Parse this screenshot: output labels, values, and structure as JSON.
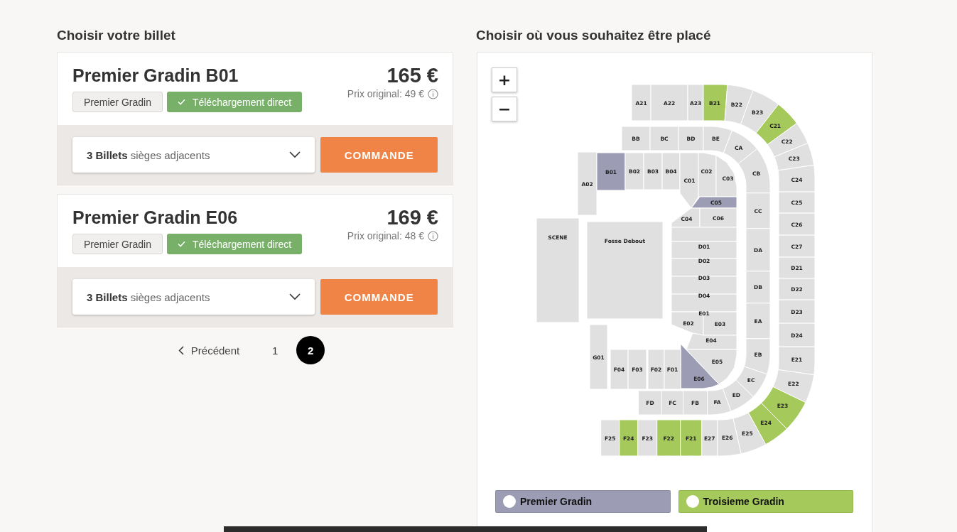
{
  "ticket_panel": {
    "heading": "Choisir votre billet",
    "tickets": [
      {
        "title": "Premier Gradin B01",
        "price": "165 €",
        "original_price": "Prix original: 49 €",
        "tags": [
          {
            "kind": "category",
            "label": "Premier Gradin"
          },
          {
            "kind": "download",
            "label": "Téléchargement direct"
          }
        ],
        "quantity": "**3 Billets** sièges adjacents",
        "order_button": "COMMANDE"
      },
      {
        "title": "Premier Gradin E06",
        "price": "169 €",
        "original_price": "Prix original: 48 €",
        "tags": [
          {
            "kind": "category",
            "label": "Premier Gradin"
          },
          {
            "kind": "download",
            "label": "Téléchargement direct"
          }
        ],
        "quantity": "**3 Billets** sièges adjacents",
        "order_button": "COMMANDE"
      }
    ],
    "pagination": {
      "previous": "Précédent",
      "pages": [
        {
          "label": "1",
          "selected": false
        },
        {
          "label": "2",
          "selected": true
        }
      ]
    }
  },
  "seat_map": {
    "heading": "Choisir où vous souhaitez être placé",
    "zoom_in": "+",
    "zoom_out": "−",
    "sections": [
      {
        "label": "A21",
        "color": "#e0e0e0"
      },
      {
        "label": "A22",
        "color": "#e0e0e0"
      },
      {
        "label": "A23",
        "color": "#e0e0e0"
      },
      {
        "label": "B21",
        "color": "#a5c95a"
      },
      {
        "label": "B22",
        "color": "#e0e0e0"
      },
      {
        "label": "B23",
        "color": "#e0e0e0"
      },
      {
        "label": "C21",
        "color": "#a5c95a"
      },
      {
        "label": "C22",
        "color": "#e0e0e0"
      },
      {
        "label": "C23",
        "color": "#e0e0e0"
      },
      {
        "label": "C24",
        "color": "#e0e0e0"
      },
      {
        "label": "C25",
        "color": "#e0e0e0"
      },
      {
        "label": "C26",
        "color": "#e0e0e0"
      },
      {
        "label": "C27",
        "color": "#e0e0e0"
      },
      {
        "label": "D21",
        "color": "#e0e0e0"
      },
      {
        "label": "D22",
        "color": "#e0e0e0"
      },
      {
        "label": "D23",
        "color": "#e0e0e0"
      },
      {
        "label": "D24",
        "color": "#e0e0e0"
      },
      {
        "label": "E21",
        "color": "#e0e0e0"
      },
      {
        "label": "E22",
        "color": "#e0e0e0"
      },
      {
        "label": "E23",
        "color": "#a5c95a"
      },
      {
        "label": "E24",
        "color": "#a5c95a"
      },
      {
        "label": "E25",
        "color": "#e0e0e0"
      },
      {
        "label": "F25",
        "color": "#e0e0e0"
      },
      {
        "label": "F24",
        "color": "#a5c95a"
      },
      {
        "label": "F23",
        "color": "#e0e0e0"
      },
      {
        "label": "F22",
        "color": "#a5c95a"
      },
      {
        "label": "F21",
        "color": "#a5c95a"
      },
      {
        "label": "E27",
        "color": "#e0e0e0"
      },
      {
        "label": "E26",
        "color": "#e0e0e0"
      },
      {
        "label": "BB",
        "color": "#e0e0e0"
      },
      {
        "label": "BC",
        "color": "#e0e0e0"
      },
      {
        "label": "BD",
        "color": "#e0e0e0"
      },
      {
        "label": "BE",
        "color": "#e0e0e0"
      },
      {
        "label": "CA",
        "color": "#e0e0e0"
      },
      {
        "label": "CB",
        "color": "#e0e0e0"
      },
      {
        "label": "CC",
        "color": "#e0e0e0"
      },
      {
        "label": "DA",
        "color": "#e0e0e0"
      },
      {
        "label": "DB",
        "color": "#e0e0e0"
      },
      {
        "label": "EA",
        "color": "#e0e0e0"
      },
      {
        "label": "EB",
        "color": "#e0e0e0"
      },
      {
        "label": "EC",
        "color": "#e0e0e0"
      },
      {
        "label": "ED",
        "color": "#e0e0e0"
      },
      {
        "label": "FD",
        "color": "#e0e0e0"
      },
      {
        "label": "FC",
        "color": "#e0e0e0"
      },
      {
        "label": "FB",
        "color": "#e0e0e0"
      },
      {
        "label": "FA",
        "color": "#e0e0e0"
      },
      {
        "label": "A02",
        "color": "#e0e0e0"
      },
      {
        "label": "B01",
        "color": "#9c9cb4"
      },
      {
        "label": "B02",
        "color": "#e0e0e0"
      },
      {
        "label": "B03",
        "color": "#e0e0e0"
      },
      {
        "label": "B04",
        "color": "#e0e0e0"
      },
      {
        "label": "C01",
        "color": "#e0e0e0"
      },
      {
        "label": "C02",
        "color": "#e0e0e0"
      },
      {
        "label": "C03",
        "color": "#e0e0e0"
      },
      {
        "label": "C05",
        "color": "#9c9cb4"
      },
      {
        "label": "C04",
        "color": "#e0e0e0"
      },
      {
        "label": "C06",
        "color": "#e0e0e0"
      },
      {
        "label": "D01",
        "color": "#e0e0e0"
      },
      {
        "label": "D02",
        "color": "#e0e0e0"
      },
      {
        "label": "D03",
        "color": "#e0e0e0"
      },
      {
        "label": "D04",
        "color": "#e0e0e0"
      },
      {
        "label": "E01",
        "color": "#e0e0e0"
      },
      {
        "label": "E02",
        "color": "#e0e0e0"
      },
      {
        "label": "E03",
        "color": "#e0e0e0"
      },
      {
        "label": "E04",
        "color": "#e0e0e0"
      },
      {
        "label": "E05",
        "color": "#e0e0e0"
      },
      {
        "label": "E06",
        "color": "#9c9cb4"
      },
      {
        "label": "G01",
        "color": "#e0e0e0"
      },
      {
        "label": "F04",
        "color": "#e0e0e0"
      },
      {
        "label": "F03",
        "color": "#e0e0e0"
      },
      {
        "label": "F02",
        "color": "#e0e0e0"
      },
      {
        "label": "F01",
        "color": "#e0e0e0"
      },
      {
        "label": "SCENE",
        "color": "#e0e0e0"
      },
      {
        "label": "Fosse Debout",
        "color": "#e0e0e0"
      }
    ],
    "legend": [
      {
        "label": "Premier Gradin",
        "color": "#9c9cb4",
        "selected": false
      },
      {
        "label": "Troisieme Gradin",
        "color": "#a5c95a",
        "selected": false
      }
    ]
  }
}
